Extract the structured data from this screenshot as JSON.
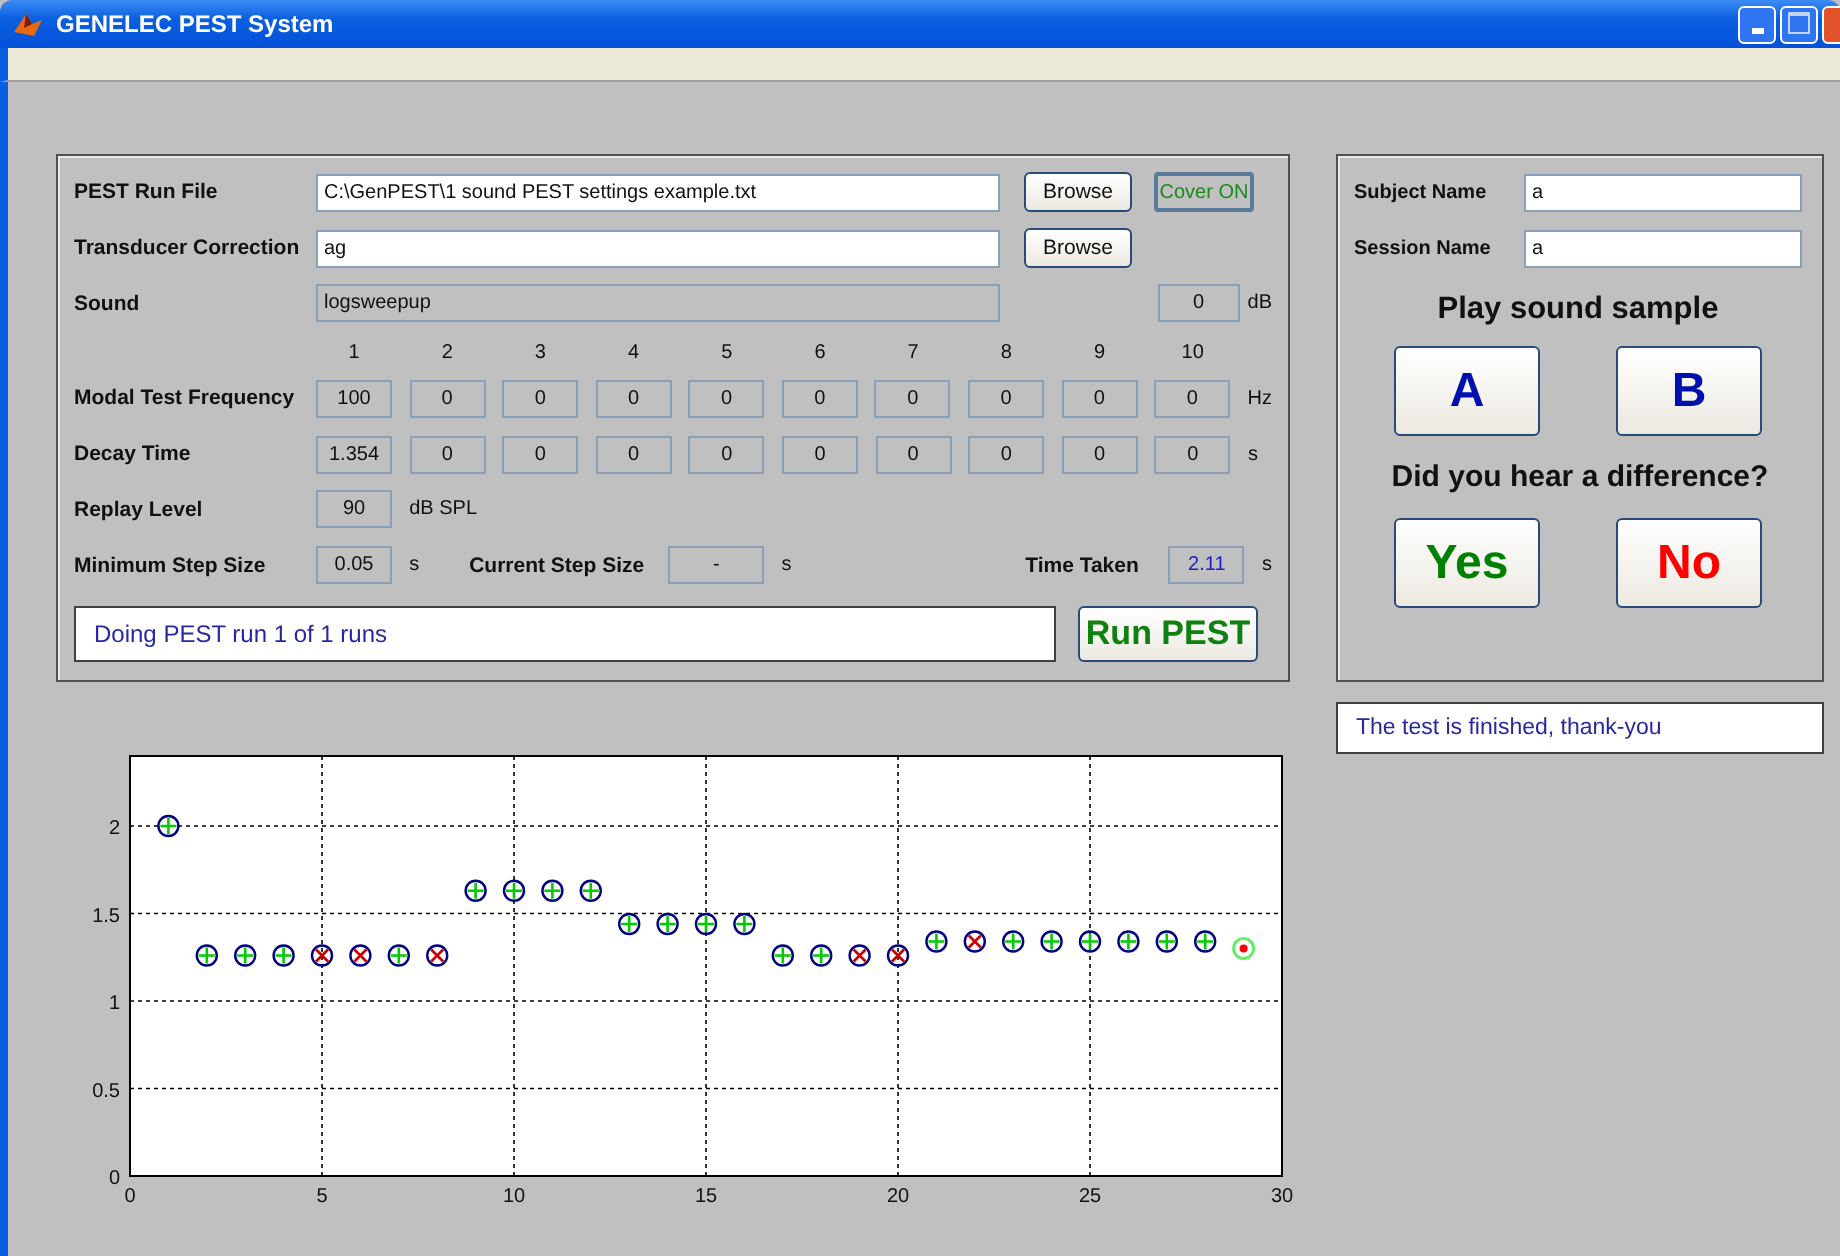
{
  "window": {
    "title": "GENELEC PEST System"
  },
  "run_panel": {
    "run_file": {
      "label": "PEST Run File",
      "value": "C:\\GenPEST\\1  sound PEST settings example.txt",
      "browse": "Browse"
    },
    "cover_button": "Cover ON",
    "transducer": {
      "label": "Transducer Correction",
      "value": "ag",
      "browse": "Browse"
    },
    "sound": {
      "label": "Sound",
      "value": "logsweepup",
      "gain": "0",
      "gain_unit": "dB"
    },
    "columns": [
      "1",
      "2",
      "3",
      "4",
      "5",
      "6",
      "7",
      "8",
      "9",
      "10"
    ],
    "param_rows": [
      {
        "label": "Modal Test Frequency",
        "values": [
          "100",
          "0",
          "0",
          "0",
          "0",
          "0",
          "0",
          "0",
          "0",
          "0"
        ],
        "unit": "Hz"
      },
      {
        "label": "Decay Time",
        "values": [
          "1.354",
          "0",
          "0",
          "0",
          "0",
          "0",
          "0",
          "0",
          "0",
          "0"
        ],
        "unit": "s"
      }
    ],
    "replay_level": {
      "label": "Replay Level",
      "value": "90",
      "unit": "dB SPL"
    },
    "min_step": {
      "label": "Minimum Step Size",
      "value": "0.05",
      "unit": "s"
    },
    "current_step": {
      "label": "Current Step Size",
      "value": "-",
      "unit": "s"
    },
    "time_taken": {
      "label": "Time Taken",
      "value": "2.11",
      "unit": "s"
    },
    "status": "Doing PEST run 1 of 1 runs",
    "run_button": "Run PEST"
  },
  "subject_panel": {
    "subject": {
      "label": "Subject Name",
      "value": "a"
    },
    "session": {
      "label": "Session Name",
      "value": "a"
    },
    "play_heading": "Play sound sample",
    "play_buttons": [
      "A",
      "B"
    ],
    "question": "Did you hear a difference?",
    "answer_buttons": [
      {
        "label": "Yes",
        "color": "#008000"
      },
      {
        "label": "No",
        "color": "#ff0000"
      }
    ]
  },
  "message": "The test is finished, thank-you",
  "plot": {
    "chart_data": {
      "type": "scatter",
      "x": [
        1,
        2,
        3,
        4,
        5,
        6,
        7,
        8,
        9,
        10,
        11,
        12,
        13,
        14,
        15,
        16,
        17,
        18,
        19,
        20,
        21,
        22,
        23,
        24,
        25,
        26,
        27,
        28,
        29
      ],
      "series": [
        {
          "color": "#00cc00",
          "marker": "plus",
          "values": [
            2,
            1.26,
            1.26,
            1.26,
            null,
            null,
            1.26,
            null,
            1.63,
            1.63,
            1.63,
            1.63,
            1.44,
            1.44,
            1.44,
            1.44,
            1.26,
            1.26,
            null,
            null,
            1.34,
            null,
            1.34,
            1.34,
            1.34,
            1.34,
            1.34,
            1.34,
            null
          ]
        },
        {
          "color": "#cc0000",
          "marker": "cross",
          "values": [
            null,
            null,
            null,
            null,
            1.26,
            1.26,
            null,
            1.26,
            null,
            null,
            null,
            null,
            null,
            null,
            null,
            null,
            null,
            null,
            1.26,
            1.26,
            null,
            1.34,
            null,
            null,
            null,
            null,
            null,
            null,
            null
          ]
        },
        {
          "color": "#ff0000",
          "marker": "dot",
          "values": [
            null,
            null,
            null,
            null,
            null,
            null,
            null,
            null,
            null,
            null,
            null,
            null,
            null,
            null,
            null,
            null,
            null,
            null,
            null,
            null,
            null,
            null,
            null,
            null,
            null,
            null,
            null,
            null,
            1.3
          ]
        }
      ],
      "xlim": [
        0,
        30
      ],
      "ylim": [
        0,
        2.4
      ],
      "grid": true,
      "xticks": [
        0,
        5,
        10,
        15,
        20,
        25,
        30
      ],
      "yticks": [
        0,
        0.5,
        1,
        1.5,
        2
      ]
    }
  }
}
